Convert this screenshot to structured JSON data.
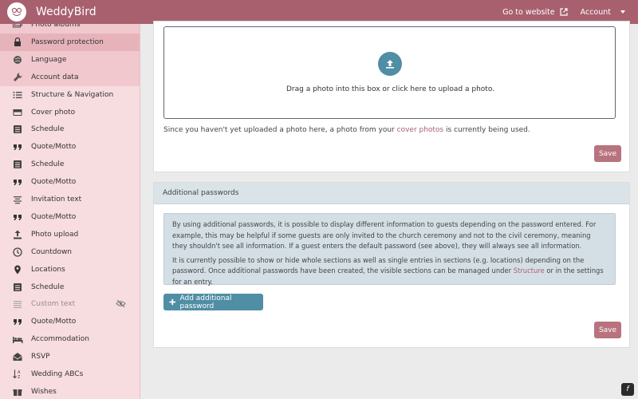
{
  "app": {
    "brand": "WeddyBird"
  },
  "topbar": {
    "go_to_website": "Go to website",
    "account": "Account"
  },
  "sidebar": {
    "items": [
      {
        "label": "Photo albums",
        "icon": "images-icon"
      },
      {
        "label": "Password protection",
        "icon": "lock-icon"
      },
      {
        "label": "Language",
        "icon": "globe-icon"
      },
      {
        "label": "Account data",
        "icon": "wrench-icon"
      },
      {
        "label": "Structure & Navigation",
        "icon": "list-icon"
      },
      {
        "label": "Cover photo",
        "icon": "cover-photo-icon"
      },
      {
        "label": "Schedule",
        "icon": "schedule-icon"
      },
      {
        "label": "Quote/Motto",
        "icon": "quote-icon"
      },
      {
        "label": "Schedule",
        "icon": "schedule-icon"
      },
      {
        "label": "Quote/Motto",
        "icon": "quote-icon"
      },
      {
        "label": "Invitation text",
        "icon": "align-center-icon"
      },
      {
        "label": "Quote/Motto",
        "icon": "quote-icon"
      },
      {
        "label": "Photo upload",
        "icon": "upload-icon"
      },
      {
        "label": "Countdown",
        "icon": "clock-icon"
      },
      {
        "label": "Locations",
        "icon": "map-marker-icon"
      },
      {
        "label": "Schedule",
        "icon": "schedule-icon"
      },
      {
        "label": "Custom text",
        "icon": "align-justify-icon"
      },
      {
        "label": "Quote/Motto",
        "icon": "quote-icon"
      },
      {
        "label": "Accommodation",
        "icon": "bed-icon"
      },
      {
        "label": "RSVP",
        "icon": "envelope-open-icon"
      },
      {
        "label": "Wedding ABCs",
        "icon": "sort-alpha-icon"
      },
      {
        "label": "Wishes",
        "icon": "gift-icon"
      }
    ]
  },
  "upload_card": {
    "drop_text": "Drag a photo into this box or click here to upload a photo.",
    "note_before": "Since you haven't yet uploaded a photo here, a photo from your ",
    "note_link": "cover photos",
    "note_after": " is currently being used.",
    "save_label": "Save"
  },
  "passwords_card": {
    "title": "Additional passwords",
    "info_p1": "By using additional passwords, it is possible to display different information to guests depending on the password entered. For example, this may be helpful if some guests are only invited to the church ceremony and not to the civil ceremony, meaning they shouldn't see all information. If a guest enters the default password (see above), they will always see all information.",
    "info_p2_before": "It is currently possible to show or hide whole sections as well as single entries in sections (e.g. locations) depending on the password. Once additional passwords have been created, the visible sections can be managed under ",
    "info_p2_link": "Structure",
    "info_p2_after": " or in the settings for an entry.",
    "add_label": "Add additional password",
    "save_label": "Save"
  },
  "colors": {
    "accent": "#a8606f",
    "primary": "#4f8ea4",
    "sidebar_bg": "#f7dce0"
  }
}
